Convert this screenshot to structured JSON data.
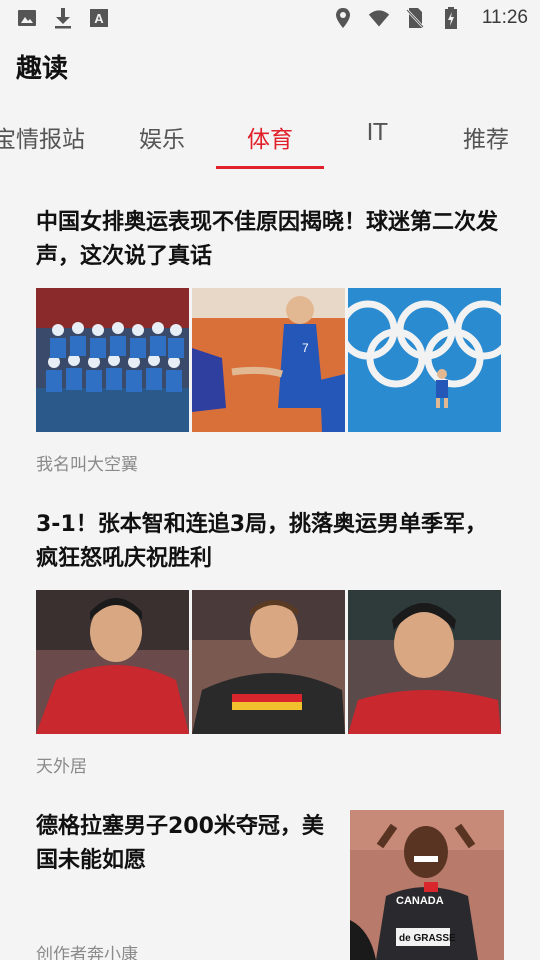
{
  "status_bar": {
    "left_icons": [
      "image-icon",
      "download-icon",
      "font-app-icon"
    ],
    "right_icons": [
      "location-icon",
      "wifi-icon",
      "no-sim-icon",
      "battery-charging-icon"
    ],
    "time": "11:26"
  },
  "header": {
    "title": "趣读"
  },
  "tabs": [
    {
      "label": "宝情报站",
      "active": false
    },
    {
      "label": "娱乐",
      "active": false
    },
    {
      "label": "体育",
      "active": true
    },
    {
      "label": "IT",
      "active": false
    },
    {
      "label": "推荐",
      "active": false
    }
  ],
  "colors": {
    "accent": "#e0202a",
    "background": "#f4f4f4",
    "muted": "#8a8a8a"
  },
  "articles": [
    {
      "title": "中国女排奥运表现不佳原因揭晓！球迷第二次发声，这次说了真话",
      "author": "我名叫大空翼",
      "images": [
        "team-photo",
        "players-high-five",
        "olympic-rings-court"
      ]
    },
    {
      "title": "3-1！张本智和连追3局，挑落奥运男单季军，疯狂怒吼庆祝胜利",
      "author": "天外居",
      "images": [
        "player-red-shirt",
        "player-german-jersey",
        "player-closeup"
      ]
    },
    {
      "title": "德格拉塞男子200米夺冠，美国未能如愿",
      "author": "创作者奔小康",
      "images": [
        "sprinter-celebration"
      ],
      "image_badge": "de GRASSE",
      "jersey_text": "CANADA"
    }
  ]
}
